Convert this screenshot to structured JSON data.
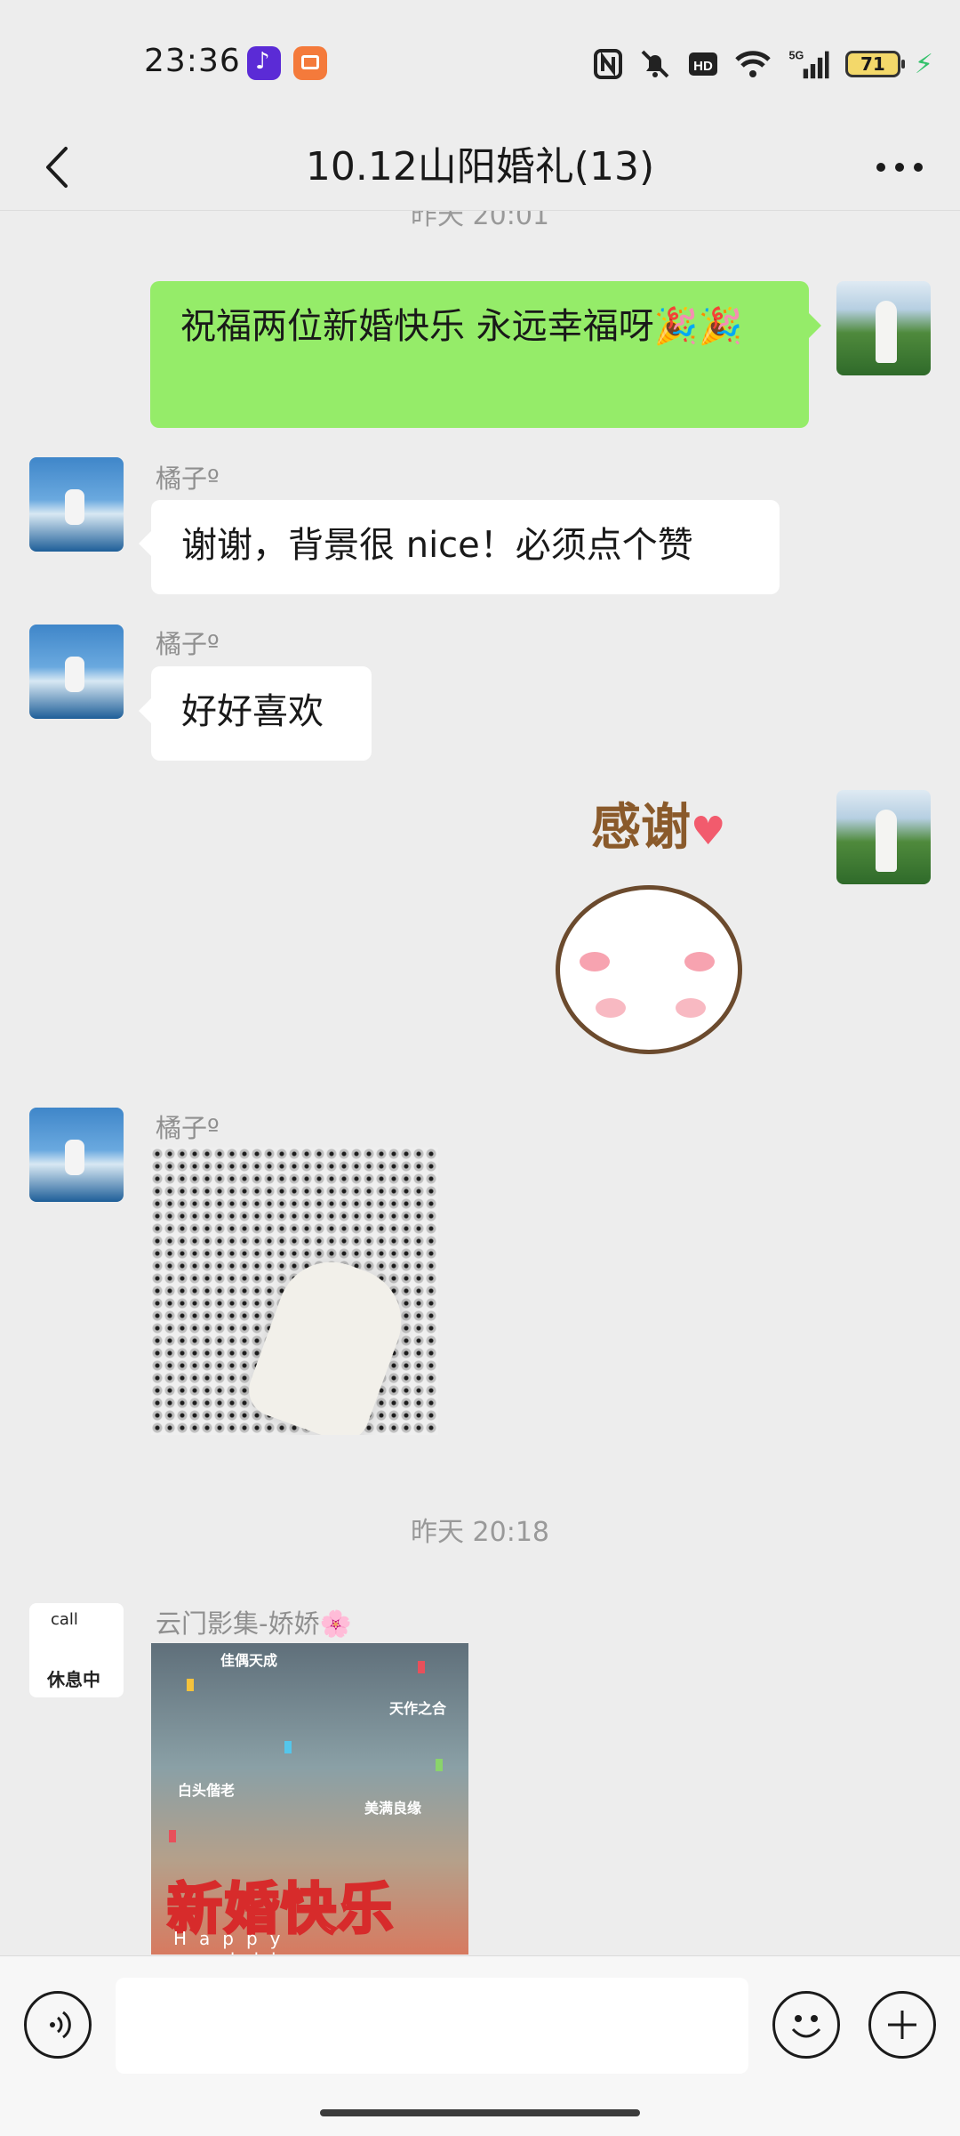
{
  "status_bar": {
    "time": "23:36",
    "network": "5G",
    "battery_level": "71",
    "icons": [
      "tiktok-icon",
      "books-icon",
      "nfc-icon",
      "mute-icon",
      "hd-icon",
      "wifi-icon",
      "signal-icon",
      "battery-icon",
      "charging-icon"
    ]
  },
  "header": {
    "title": "10.12山阳婚礼(13)"
  },
  "messages": {
    "partial_timestamp": "昨天 20:01",
    "msg1_text": "祝福两位新婚快乐  永远幸福呀🎉🎉",
    "msg2_sender": "橘子º",
    "msg2_text": "谢谢，背景很 nice！必须点个赞",
    "msg3_sender": "橘子º",
    "msg3_text": "好好喜欢",
    "sticker_text": "感谢",
    "msg5_sender": "橘子º",
    "timestamp2": "昨天 20:18",
    "msg6_sender": "云门影集-娇娇🌸",
    "avatar_cloud_text": "休息中",
    "avatar_cloud_call": "call",
    "poster_title": "新婚快乐",
    "poster_subtitle": "Happy wedding",
    "poster_tags": [
      "佳偶天成",
      "天作之合",
      "白头偕老",
      "美满良缘"
    ]
  },
  "input_bar": {
    "placeholder": ""
  },
  "colors": {
    "chat_bg": "#ededed",
    "outgoing_bubble": "#95ec69",
    "incoming_bubble": "#ffffff",
    "muted_text": "#999999"
  }
}
